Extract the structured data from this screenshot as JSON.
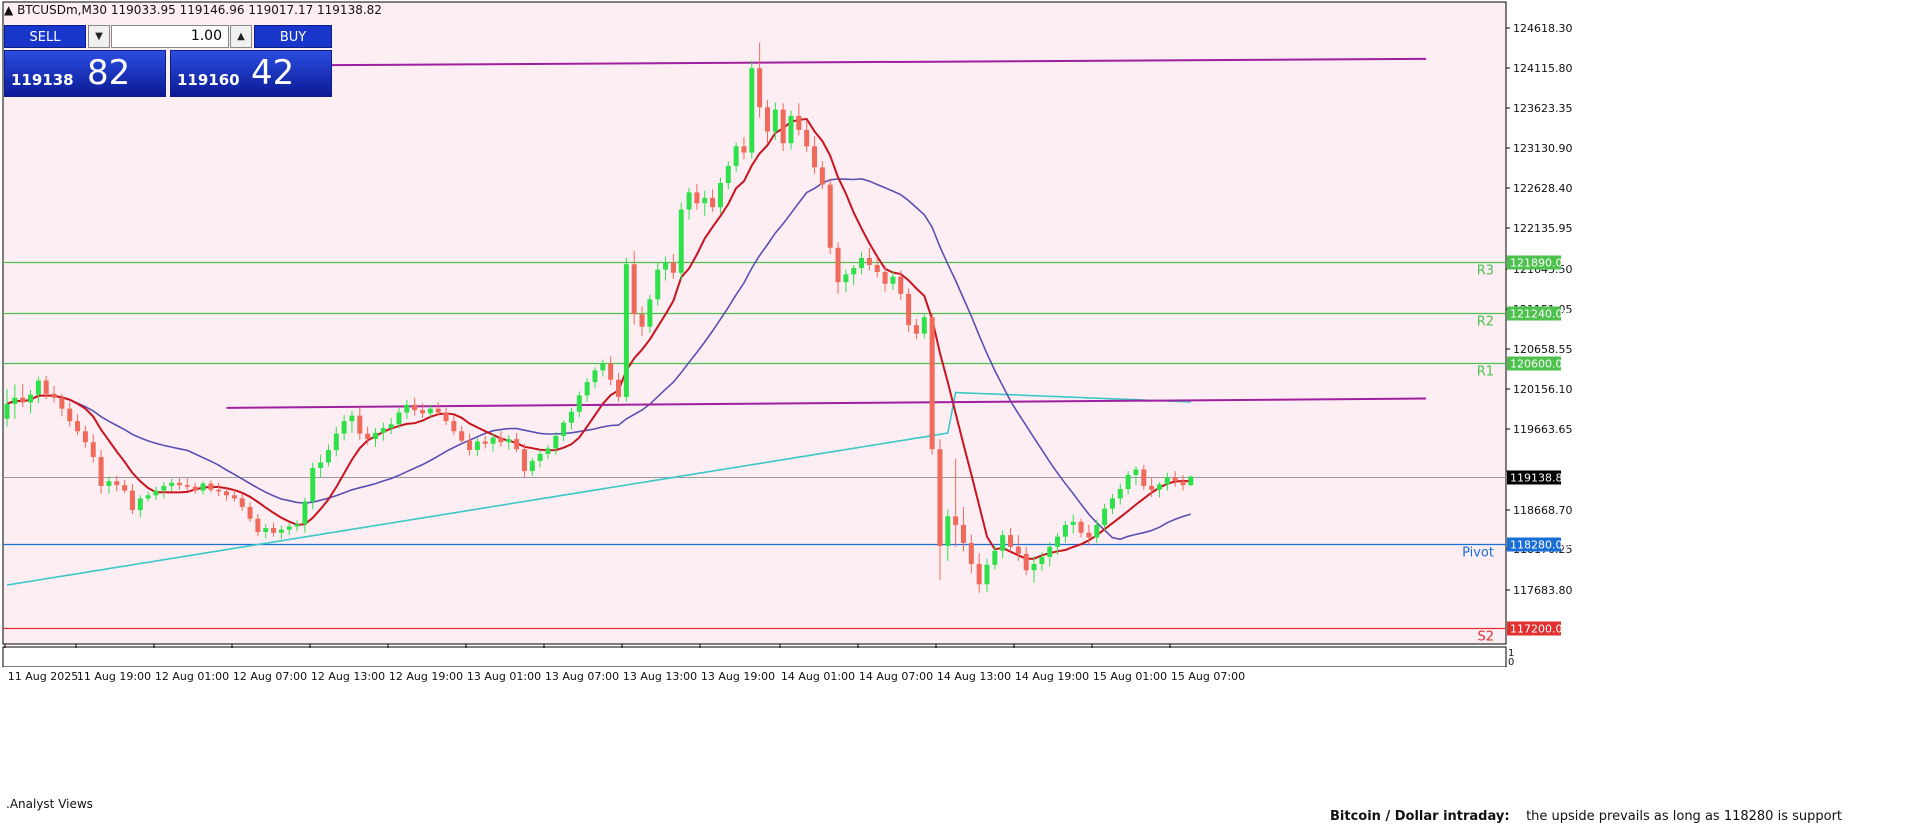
{
  "header": {
    "symbol": "BTCUSDm,M30",
    "ohlc": "119033.95 119146.96 119017.17 119138.82"
  },
  "trade_panel": {
    "sell_label": "SELL",
    "buy_label": "BUY",
    "lot": "1.00",
    "bid_small": "119138",
    "bid_big": "82",
    "ask_small": "119160",
    "ask_big": "42"
  },
  "subwindow_label": ".Analyst Views",
  "subwindow_scale": [
    "1",
    "0"
  ],
  "footer": {
    "title": "Bitcoin / Dollar intraday:",
    "text": "the upside prevails as long as 118280 is support"
  },
  "colors": {
    "background": "#fdeef4",
    "bull": "#2ee04a",
    "bear": "#ef6a5a",
    "ma_fast": "#c8141e",
    "ma_mid": "#5a50b4",
    "ma_slow": "#3cc8c8",
    "trend": "#a0209e",
    "levels": "#4cc24c",
    "pivot": "#1a6fd6",
    "support": "#e03030"
  },
  "chart_data": {
    "type": "candlestick",
    "ylim": [
      117200,
      124860
    ],
    "ytick_labels": [
      "124618.30",
      "124115.80",
      "123623.35",
      "123130.90",
      "122628.40",
      "122135.95",
      "121643.50",
      "121151.05",
      "120658.55",
      "120156.10",
      "119663.65",
      "119138.82",
      "118668.70",
      "118176.25",
      "117683.80"
    ],
    "xtick_labels": [
      "11 Aug 2025",
      "11 Aug 19:00",
      "12 Aug 01:00",
      "12 Aug 07:00",
      "12 Aug 13:00",
      "12 Aug 19:00",
      "13 Aug 01:00",
      "13 Aug 07:00",
      "13 Aug 13:00",
      "13 Aug 19:00",
      "14 Aug 01:00",
      "14 Aug 07:00",
      "14 Aug 13:00",
      "14 Aug 19:00",
      "15 Aug 01:00",
      "15 Aug 07:00"
    ],
    "current_price": {
      "value": 119138.82,
      "label": "119138.82"
    },
    "levels": [
      {
        "name": "R3",
        "value": 121890.0,
        "label": "121890.00"
      },
      {
        "name": "R2",
        "value": 121240.0,
        "label": "121240.00"
      },
      {
        "name": "R1",
        "value": 120600.0,
        "label": "120600.00"
      },
      {
        "name": "Pivot",
        "value": 118280.0,
        "label": "118280.00"
      },
      {
        "name": "S2",
        "value": 117200.0,
        "label": "117200.00"
      }
    ],
    "trendlines": [
      {
        "x1": 41,
        "y1": 124410,
        "x2": 181,
        "y2": 124490
      },
      {
        "x1": 28,
        "y1": 120020,
        "x2": 181,
        "y2": 120140
      }
    ],
    "candles": [
      [
        119880,
        120260,
        119780,
        120070
      ],
      [
        120070,
        120320,
        119880,
        120150
      ],
      [
        120150,
        120330,
        120030,
        120090
      ],
      [
        120090,
        120250,
        119950,
        120190
      ],
      [
        120190,
        120420,
        120080,
        120370
      ],
      [
        120370,
        120430,
        120130,
        120200
      ],
      [
        120200,
        120300,
        120090,
        120150
      ],
      [
        120150,
        120200,
        119910,
        120010
      ],
      [
        120010,
        120090,
        119780,
        119850
      ],
      [
        119850,
        119940,
        119670,
        119720
      ],
      [
        119720,
        119790,
        119510,
        119580
      ],
      [
        119580,
        119680,
        119320,
        119390
      ],
      [
        119390,
        119480,
        118920,
        119020
      ],
      [
        119020,
        119140,
        118920,
        119080
      ],
      [
        119080,
        119150,
        118950,
        119030
      ],
      [
        119030,
        119100,
        118930,
        118960
      ],
      [
        118960,
        119040,
        118660,
        118710
      ],
      [
        118710,
        118900,
        118620,
        118860
      ],
      [
        118860,
        118950,
        118820,
        118900
      ],
      [
        118900,
        119010,
        118840,
        118960
      ],
      [
        118960,
        119070,
        118860,
        119020
      ],
      [
        119020,
        119110,
        118950,
        119060
      ],
      [
        119060,
        119120,
        118970,
        119030
      ],
      [
        119030,
        119120,
        118960,
        119010
      ],
      [
        119010,
        119060,
        118920,
        118960
      ],
      [
        118960,
        119080,
        118910,
        119050
      ],
      [
        119050,
        119090,
        118940,
        118970
      ],
      [
        118970,
        119060,
        118890,
        118950
      ],
      [
        118950,
        119010,
        118830,
        118900
      ],
      [
        118900,
        118970,
        118820,
        118860
      ],
      [
        118860,
        118920,
        118700,
        118750
      ],
      [
        118750,
        118810,
        118560,
        118600
      ],
      [
        118600,
        118660,
        118380,
        118430
      ],
      [
        118430,
        118530,
        118350,
        118480
      ],
      [
        118480,
        118550,
        118370,
        118420
      ],
      [
        118420,
        118510,
        118340,
        118460
      ],
      [
        118460,
        118540,
        118390,
        118500
      ],
      [
        118500,
        118580,
        118440,
        118530
      ],
      [
        118530,
        118870,
        118420,
        118820
      ],
      [
        118820,
        119320,
        118720,
        119250
      ],
      [
        119250,
        119420,
        119130,
        119320
      ],
      [
        119320,
        119550,
        119270,
        119480
      ],
      [
        119480,
        119780,
        119400,
        119690
      ],
      [
        119690,
        119930,
        119600,
        119850
      ],
      [
        119850,
        119980,
        119700,
        119920
      ],
      [
        119920,
        120030,
        119610,
        119690
      ],
      [
        119690,
        119780,
        119550,
        119620
      ],
      [
        119620,
        119760,
        119520,
        119700
      ],
      [
        119700,
        119830,
        119600,
        119760
      ],
      [
        119760,
        119890,
        119680,
        119810
      ],
      [
        119810,
        120020,
        119760,
        119960
      ],
      [
        119960,
        120120,
        119880,
        120060
      ],
      [
        120060,
        120150,
        119920,
        119990
      ],
      [
        119990,
        120080,
        119890,
        119950
      ],
      [
        119950,
        120060,
        119900,
        120010
      ],
      [
        120010,
        120090,
        119920,
        119960
      ],
      [
        119960,
        120020,
        119800,
        119850
      ],
      [
        119850,
        119920,
        119670,
        119720
      ],
      [
        119720,
        119790,
        119560,
        119600
      ],
      [
        119600,
        119690,
        119410,
        119480
      ],
      [
        119480,
        119640,
        119400,
        119590
      ],
      [
        119590,
        119660,
        119500,
        119560
      ],
      [
        119560,
        119690,
        119460,
        119640
      ],
      [
        119640,
        119720,
        119520,
        119580
      ],
      [
        119580,
        119670,
        119480,
        119620
      ],
      [
        119620,
        119700,
        119450,
        119490
      ],
      [
        119490,
        119560,
        119130,
        119210
      ],
      [
        119210,
        119380,
        119150,
        119340
      ],
      [
        119340,
        119490,
        119260,
        119430
      ],
      [
        119430,
        119540,
        119360,
        119500
      ],
      [
        119500,
        119710,
        119420,
        119660
      ],
      [
        119660,
        119860,
        119590,
        119830
      ],
      [
        119830,
        120020,
        119740,
        119970
      ],
      [
        119970,
        120230,
        119900,
        120180
      ],
      [
        120180,
        120400,
        120100,
        120350
      ],
      [
        120350,
        120540,
        120270,
        120500
      ],
      [
        120500,
        120640,
        120420,
        120590
      ],
      [
        120590,
        120680,
        120310,
        120380
      ],
      [
        120380,
        120470,
        120100,
        120160
      ],
      [
        120160,
        121940,
        120100,
        121860
      ],
      [
        121860,
        122030,
        121090,
        121220
      ],
      [
        121220,
        121320,
        120940,
        121060
      ],
      [
        121060,
        121470,
        120980,
        121410
      ],
      [
        121410,
        121880,
        121330,
        121790
      ],
      [
        121790,
        121960,
        121650,
        121880
      ],
      [
        121880,
        121990,
        121670,
        121750
      ],
      [
        121750,
        122650,
        121660,
        122560
      ],
      [
        122560,
        122840,
        122430,
        122780
      ],
      [
        122780,
        122890,
        122560,
        122640
      ],
      [
        122640,
        122800,
        122480,
        122710
      ],
      [
        122710,
        122820,
        122530,
        122590
      ],
      [
        122590,
        122970,
        122510,
        122900
      ],
      [
        122900,
        123180,
        122820,
        123120
      ],
      [
        123120,
        123420,
        123040,
        123370
      ],
      [
        123370,
        123490,
        123200,
        123290
      ],
      [
        123290,
        124470,
        123210,
        124370
      ],
      [
        124370,
        124700,
        123740,
        123870
      ],
      [
        123870,
        123960,
        123410,
        123560
      ],
      [
        123560,
        123930,
        123450,
        123840
      ],
      [
        123840,
        123920,
        123310,
        123410
      ],
      [
        123410,
        123830,
        123330,
        123760
      ],
      [
        123760,
        123920,
        123510,
        123580
      ],
      [
        123580,
        123710,
        123300,
        123370
      ],
      [
        123370,
        123500,
        123020,
        123100
      ],
      [
        123100,
        123180,
        122820,
        122880
      ],
      [
        122880,
        122950,
        121990,
        122070
      ],
      [
        122070,
        122140,
        121480,
        121630
      ],
      [
        121630,
        121790,
        121500,
        121730
      ],
      [
        121730,
        121850,
        121590,
        121810
      ],
      [
        121810,
        122020,
        121730,
        121940
      ],
      [
        121940,
        122070,
        121780,
        121850
      ],
      [
        121850,
        121950,
        121690,
        121760
      ],
      [
        121760,
        121840,
        121510,
        121610
      ],
      [
        121610,
        121780,
        121530,
        121700
      ],
      [
        121700,
        121780,
        121400,
        121480
      ],
      [
        121480,
        121550,
        120990,
        121080
      ],
      [
        121080,
        121160,
        120900,
        120970
      ],
      [
        120970,
        121220,
        120910,
        121180
      ],
      [
        121180,
        121230,
        119420,
        119490
      ],
      [
        119490,
        119620,
        117810,
        118250
      ],
      [
        118250,
        118720,
        118060,
        118630
      ],
      [
        118630,
        119370,
        118240,
        118520
      ],
      [
        118520,
        118750,
        118180,
        118290
      ],
      [
        118290,
        118400,
        117900,
        118020
      ],
      [
        118020,
        118160,
        117650,
        117760
      ],
      [
        117760,
        118090,
        117660,
        118010
      ],
      [
        118010,
        118250,
        117950,
        118190
      ],
      [
        118190,
        118450,
        118090,
        118390
      ],
      [
        118390,
        118480,
        118180,
        118240
      ],
      [
        118240,
        118390,
        118060,
        118150
      ],
      [
        118150,
        118240,
        117880,
        117940
      ],
      [
        117940,
        118120,
        117780,
        118020
      ],
      [
        118020,
        118170,
        117930,
        118110
      ],
      [
        118110,
        118300,
        117990,
        118240
      ],
      [
        118240,
        118420,
        118140,
        118370
      ],
      [
        118370,
        118570,
        118290,
        118520
      ],
      [
        118520,
        118650,
        118410,
        118560
      ],
      [
        118560,
        118600,
        118360,
        118420
      ],
      [
        118420,
        118520,
        118260,
        118360
      ],
      [
        118360,
        118590,
        118290,
        118520
      ],
      [
        118520,
        118790,
        118450,
        118730
      ],
      [
        118730,
        118920,
        118660,
        118860
      ],
      [
        118860,
        119050,
        118780,
        118980
      ],
      [
        118980,
        119210,
        118910,
        119160
      ],
      [
        119160,
        119270,
        119030,
        119230
      ],
      [
        119230,
        119290,
        118970,
        119020
      ],
      [
        119020,
        119120,
        118880,
        118970
      ],
      [
        118970,
        119070,
        118870,
        119040
      ],
      [
        119040,
        119190,
        118960,
        119130
      ],
      [
        119130,
        119210,
        119010,
        119080
      ],
      [
        119080,
        119160,
        118960,
        119030
      ],
      [
        119030,
        119150,
        119020,
        119140
      ]
    ]
  }
}
